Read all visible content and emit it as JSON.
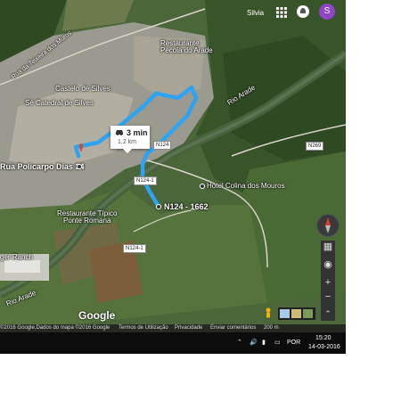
{
  "header": {
    "user_label": "Silvia",
    "avatar_letter": "S",
    "apps_icon": "apps-grid-icon",
    "notifications_icon": "notifications-icon"
  },
  "map": {
    "labels": {
      "rua_teixeira_muros": "Rua da Teixeira dos Muros",
      "restaurante_pecola": "Restaurante\nPecola do Arade",
      "castelo": "Castelo de Silves",
      "se_catedral": "Sé Catedral de Silves",
      "rio_arade_east": "Rio Arade",
      "rua_policarpo": "Rua Policarpo Dias 34",
      "hotel_colina": "Hotel Colina dos Mouros",
      "n124_1662": "N124 - 1662",
      "restaurante_tipico": "Restaurante Típico\nPonte Romana",
      "ger_ranch": "ger Ranch",
      "rio_arade_west": "Rio Arade"
    },
    "road_badges": {
      "n124_a": "N124",
      "n124_1_a": "N124-1",
      "n124_1_b": "N124-1",
      "n269": "N269"
    },
    "route": {
      "time": "3 min",
      "distance": "1,2 km",
      "mode_icon": "car-icon",
      "color": "#2ea3f2"
    },
    "controls": {
      "zoom_in": "+",
      "zoom_out": "−",
      "expand": "⌃"
    },
    "logo": "Google"
  },
  "footer": {
    "imagery": "©2016 Google,Dados do mapa ©2016 Google",
    "terms": "Termos de Utilização",
    "privacy": "Privacidade",
    "feedback": "Enviar comentários",
    "scale": "200 m"
  },
  "taskbar": {
    "language": "POR",
    "time": "15:20",
    "date": "14-03-2016"
  },
  "colors": {
    "route": "#2ea3f2",
    "avatar": "#8e44c4",
    "pin_red": "#db4437"
  }
}
